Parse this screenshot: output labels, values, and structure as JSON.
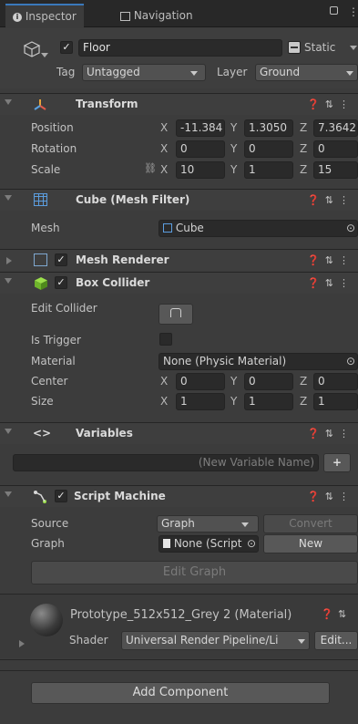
{
  "tabs": [
    {
      "label": "Inspector",
      "icon": "info-icon"
    },
    {
      "label": "Navigation",
      "icon": "navigation-icon"
    }
  ],
  "gameobject": {
    "name": "Floor",
    "active": true,
    "static_label": "Static",
    "tag_label": "Tag",
    "tag_value": "Untagged",
    "layer_label": "Layer",
    "layer_value": "Ground"
  },
  "transform": {
    "title": "Transform",
    "position_label": "Position",
    "rotation_label": "Rotation",
    "scale_label": "Scale",
    "position": {
      "x": "-11.384",
      "y": "1.3050",
      "z": "7.3642"
    },
    "rotation": {
      "x": "0",
      "y": "0",
      "z": "0"
    },
    "scale": {
      "x": "10",
      "y": "1",
      "z": "15"
    }
  },
  "mesh_filter": {
    "title": "Cube (Mesh Filter)",
    "mesh_label": "Mesh",
    "mesh_value": "Cube"
  },
  "mesh_renderer": {
    "title": "Mesh Renderer"
  },
  "box_collider": {
    "title": "Box Collider",
    "edit_collider_label": "Edit Collider",
    "is_trigger_label": "Is Trigger",
    "material_label": "Material",
    "material_value": "None (Physic Material)",
    "center_label": "Center",
    "size_label": "Size",
    "center": {
      "x": "0",
      "y": "0",
      "z": "0"
    },
    "size": {
      "x": "1",
      "y": "1",
      "z": "1"
    }
  },
  "variables": {
    "title": "Variables",
    "new_variable_placeholder": "(New Variable Name)",
    "add_label": "+"
  },
  "script_machine": {
    "title": "Script Machine",
    "source_label": "Source",
    "source_value": "Graph",
    "convert_label": "Convert",
    "graph_label": "Graph",
    "graph_value": "None (Script",
    "new_label": "New",
    "edit_graph_label": "Edit Graph"
  },
  "material": {
    "name": "Prototype_512x512_Grey 2 (Material)",
    "shader_label": "Shader",
    "shader_value": "Universal Render Pipeline/Li",
    "edit_label": "Edit..."
  },
  "add_component_label": "Add Component",
  "axes": {
    "x": "X",
    "y": "Y",
    "z": "Z"
  }
}
